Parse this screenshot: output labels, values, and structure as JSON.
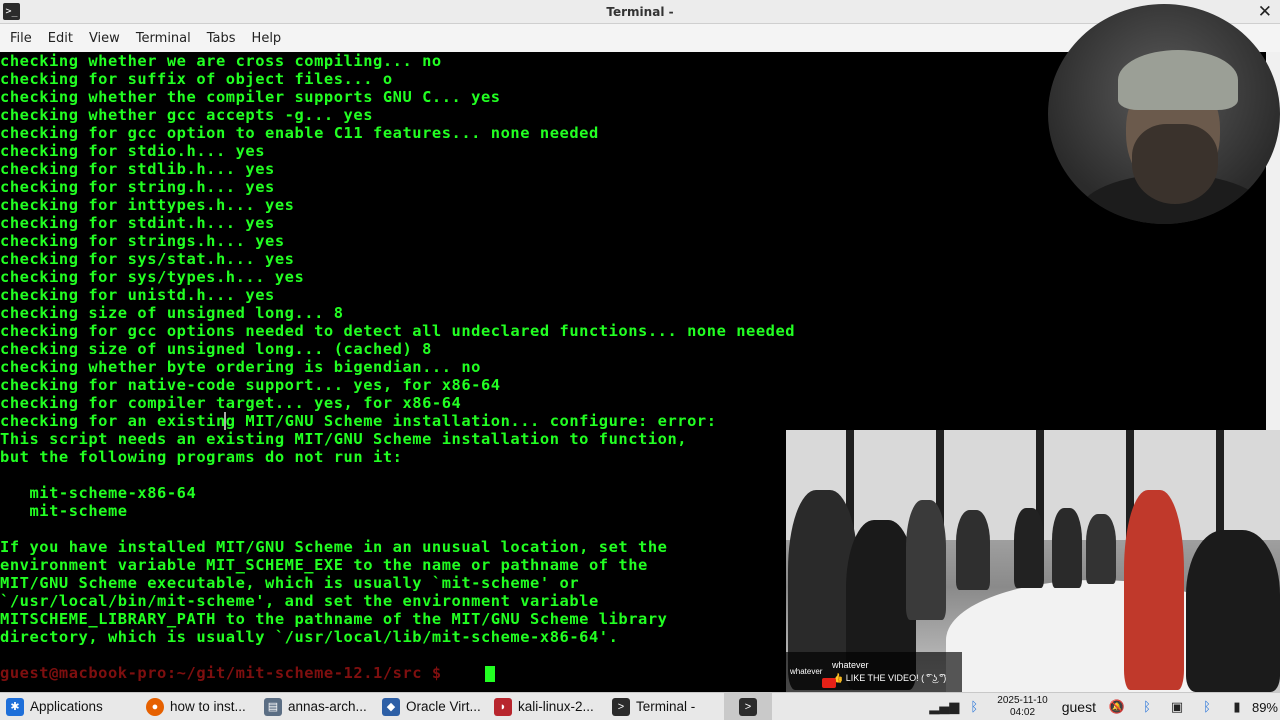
{
  "window": {
    "title": "Terminal -"
  },
  "menu": [
    "File",
    "Edit",
    "View",
    "Terminal",
    "Tabs",
    "Help"
  ],
  "terminal": {
    "lines": [
      "checking whether we are cross compiling... no",
      "checking for suffix of object files... o",
      "checking whether the compiler supports GNU C... yes",
      "checking whether gcc accepts -g... yes",
      "checking for gcc option to enable C11 features... none needed",
      "checking for stdio.h... yes",
      "checking for stdlib.h... yes",
      "checking for string.h... yes",
      "checking for inttypes.h... yes",
      "checking for stdint.h... yes",
      "checking for strings.h... yes",
      "checking for sys/stat.h... yes",
      "checking for sys/types.h... yes",
      "checking for unistd.h... yes",
      "checking size of unsigned long... 8",
      "checking for gcc options needed to detect all undeclared functions... none needed",
      "checking size of unsigned long... (cached) 8",
      "checking whether byte ordering is bigendian... no",
      "checking for native-code support... yes, for x86-64",
      "checking for compiler target... yes, for x86-64",
      "checking for an existing MIT/GNU Scheme installation... configure: error:",
      "This script needs an existing MIT/GNU Scheme installation to function,",
      "but the following programs do not run it:",
      "",
      "   mit-scheme-x86-64",
      "   mit-scheme",
      "",
      "If you have installed MIT/GNU Scheme in an unusual location, set the",
      "environment variable MIT_SCHEME_EXE to the name or pathname of the",
      "MIT/GNU Scheme executable, which is usually `mit-scheme' or",
      "`/usr/local/bin/mit-scheme', and set the environment variable",
      "MITSCHEME_LIBRARY_PATH to the pathname of the MIT/GNU Scheme library",
      "directory, which is usually `/usr/local/lib/mit-scheme-x86-64'."
    ],
    "prompt": "guest@macbook-pro:~/git/mit-scheme-12.1/src $"
  },
  "video": {
    "channel": "whatever",
    "title": "whatever",
    "subtitle": "👍 LIKE THE VIDEO! ( ͡° ͜ʖ ͡°)"
  },
  "taskbar": {
    "items": [
      {
        "label": "Applications",
        "icon": "applications-icon",
        "color": "#1e6fd9"
      },
      {
        "label": "how to inst...",
        "icon": "firefox-icon",
        "color": "#e66000"
      },
      {
        "label": "annas-arch...",
        "icon": "file-manager-icon",
        "color": "#5b6e84"
      },
      {
        "label": "Oracle Virt...",
        "icon": "virtualbox-icon",
        "color": "#2d5fa6"
      },
      {
        "label": "kali-linux-2...",
        "icon": "kali-icon",
        "color": "#b8262e"
      },
      {
        "label": "Terminal -",
        "icon": "terminal-icon",
        "color": "#2b2b2b"
      }
    ],
    "clock": {
      "date": "2025-11-10",
      "time": "04:02"
    },
    "user": "guest",
    "battery": "89%"
  }
}
